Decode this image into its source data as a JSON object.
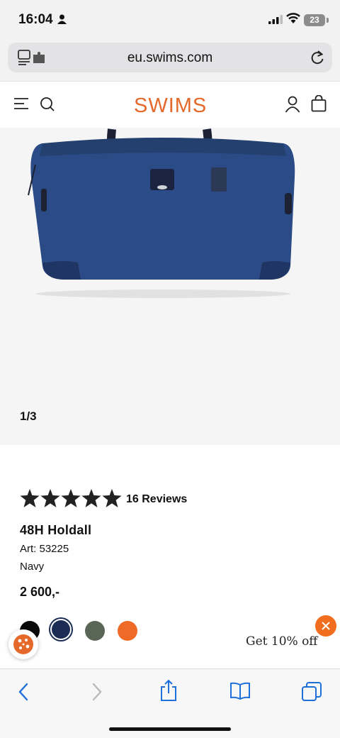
{
  "status_bar": {
    "time": "16:04",
    "battery": "23"
  },
  "browser": {
    "url": "eu.swims.com"
  },
  "site": {
    "logo_text": "SWIMS",
    "brand_color": "#e4692a",
    "icons": [
      "menu-icon",
      "search-icon",
      "account-icon",
      "shopping-bag-icon"
    ]
  },
  "gallery": {
    "counter": "1/3"
  },
  "product": {
    "rating": 4.5,
    "reviews_label": "16 Reviews",
    "name": "48H Holdall",
    "article": "Art: 53225",
    "color": "Navy",
    "price": "2 600,-",
    "swatches": [
      {
        "name": "black",
        "hex": "#0a0a0a"
      },
      {
        "name": "navy",
        "hex": "#1b2d55",
        "selected": true
      },
      {
        "name": "green",
        "hex": "#5a6655"
      },
      {
        "name": "orange",
        "hex": "#ee6a26"
      }
    ]
  },
  "promo": {
    "text": "Get 10% off"
  },
  "toolbar": {
    "icons": [
      "back-icon",
      "forward-icon",
      "share-icon",
      "bookmarks-icon",
      "tabs-icon"
    ]
  }
}
